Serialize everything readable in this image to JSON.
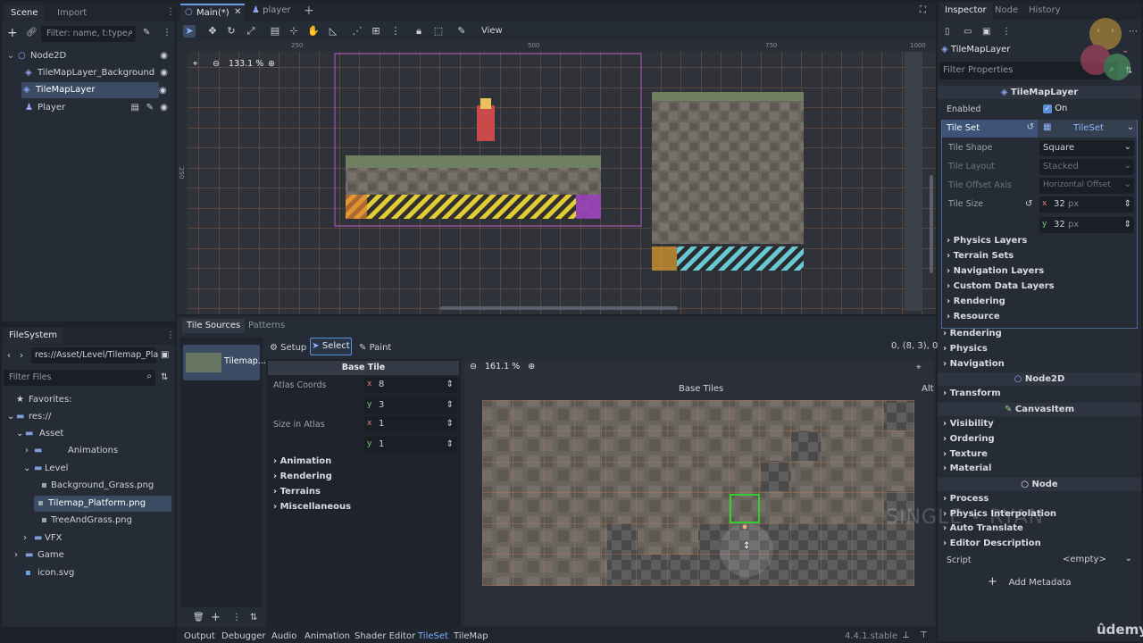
{
  "scene_dock": {
    "tabs": [
      "Scene",
      "Import"
    ],
    "filter_placeholder": "Filter: name, t:type,",
    "nodes": [
      {
        "label": "Node2D"
      },
      {
        "label": "TileMapLayer_Background"
      },
      {
        "label": "TileMapLayer"
      },
      {
        "label": "Player"
      }
    ]
  },
  "editor_tabs": {
    "main": "Main(*)",
    "player": "player"
  },
  "toolbar": {
    "view": "View"
  },
  "viewport": {
    "zoom": "133.1 %",
    "ruler_top": [
      "250",
      "500",
      "750",
      "1000"
    ],
    "ruler_left": "250"
  },
  "bottom_panel": {
    "tabs": [
      "Tile Sources",
      "Patterns"
    ],
    "source_name": "Tilemap...",
    "modes": {
      "setup": "Setup",
      "select": "Select",
      "paint": "Paint"
    },
    "coords": "0, (8, 3), 0",
    "base_tile_header": "Base Tile",
    "atlas_coords": {
      "label": "Atlas Coords",
      "x": "8",
      "y": "3"
    },
    "size_in_atlas": {
      "label": "Size in Atlas",
      "x": "1",
      "y": "1"
    },
    "groups": [
      "Animation",
      "Rendering",
      "Terrains",
      "Miscellaneous"
    ],
    "atlas_zoom": "161.1 %",
    "atlas_title": "Base Tiles",
    "alt": "Alt"
  },
  "filesystem": {
    "tab": "FileSystem",
    "path": "res://Asset/Level/Tilemap_Pla",
    "filter_placeholder": "Filter Files",
    "items": {
      "favorites": "Favorites:",
      "res": "res://",
      "asset": "Asset",
      "animations": "Animations",
      "level": "Level",
      "bg_grass": "Background_Grass.png",
      "tilemap_platform": "Tilemap_Platform.png",
      "tree_grass": "TreeAndGrass.png",
      "vfx": "VFX",
      "game": "Game",
      "icon": "icon.svg"
    }
  },
  "bottom_tabs": [
    "Output",
    "Debugger",
    "Audio",
    "Animation",
    "Shader Editor",
    "TileSet",
    "TileMap"
  ],
  "version": "4.4.1.stable",
  "inspector": {
    "tabs": [
      "Inspector",
      "Node",
      "History"
    ],
    "node_name": "TileMapLayer",
    "filter_placeholder": "Filter Properties",
    "class_header": "TileMapLayer",
    "enabled": {
      "label": "Enabled",
      "value": "On"
    },
    "tile_set": {
      "label": "Tile Set",
      "value": "TileSet"
    },
    "tile_shape": {
      "label": "Tile Shape",
      "value": "Square"
    },
    "tile_layout": {
      "label": "Tile Layout",
      "value": "Stacked"
    },
    "tile_offset_axis": {
      "label": "Tile Offset Axis",
      "value": "Horizontal Offset"
    },
    "tile_size": {
      "label": "Tile Size",
      "x": "32",
      "y": "32",
      "unit": "px"
    },
    "tileset_groups": [
      "Physics Layers",
      "Terrain Sets",
      "Navigation Layers",
      "Custom Data Layers",
      "Rendering",
      "Resource"
    ],
    "layer_groups": [
      "Rendering",
      "Physics",
      "Navigation"
    ],
    "node2d_header": "Node2D",
    "transform": "Transform",
    "canvas_header": "CanvasItem",
    "canvas_groups": [
      "Visibility",
      "Ordering",
      "Texture",
      "Material"
    ],
    "node_header": "Node",
    "node_groups": [
      "Process",
      "Physics Interpolation",
      "Auto Translate",
      "Editor Description"
    ],
    "script": {
      "label": "Script",
      "value": "<empty>"
    },
    "add_metadata": "Add Metadata"
  },
  "watermark": {
    "udemy": "ûdemy",
    "overlay": "SINGLE • RYAN"
  }
}
